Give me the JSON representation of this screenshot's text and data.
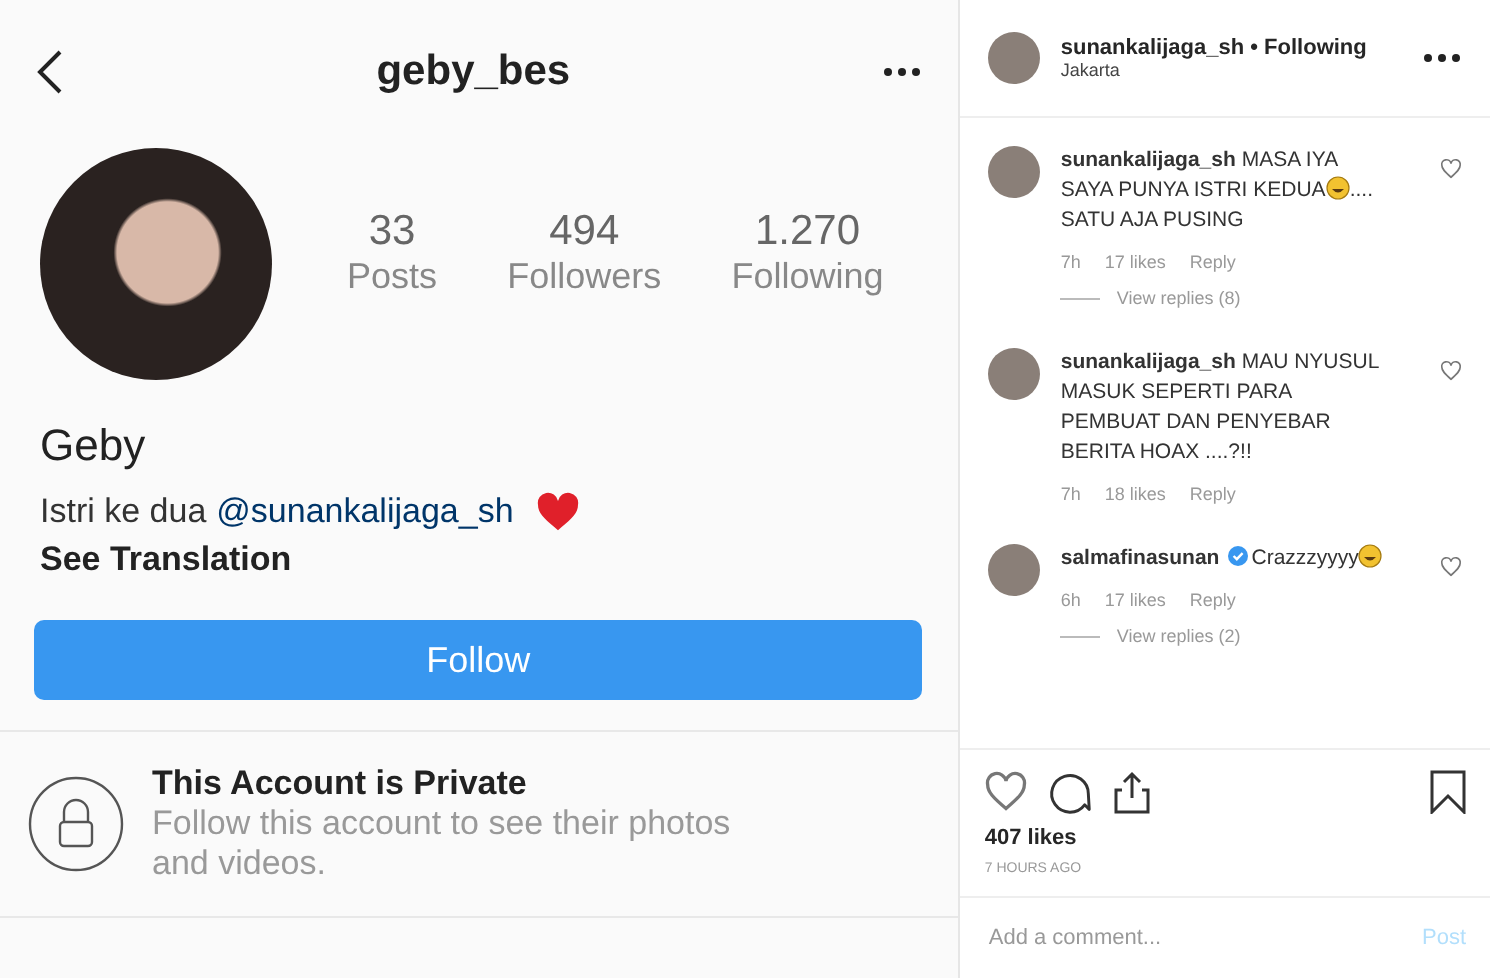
{
  "profile": {
    "username": "geby_bes",
    "stats": [
      {
        "value": "33",
        "label": "Posts"
      },
      {
        "value": "494",
        "label": "Followers"
      },
      {
        "value": "1.270",
        "label": "Following"
      }
    ],
    "name": "Geby",
    "bio": "Istri ke dua",
    "bio_mention": "@sunankalijaga_sh",
    "see_translation": "See Translation",
    "follow_button": "Follow",
    "private_title": "This Account is Private",
    "private_text": "Follow this account to see their photos and videos."
  },
  "post": {
    "author": "sunankalijaga_sh",
    "follow_state": "• Following",
    "location": "Jakarta",
    "comments": [
      {
        "author": "sunankalijaga_sh",
        "verified": false,
        "text_before": "MASA IYA SAYA PUNYA ISTRI KEDUA",
        "emoji": true,
        "text_after": ".... SATU AJA PUSING",
        "time": "7h",
        "likes": "17 likes",
        "reply": "Reply",
        "view_replies": "View replies (8)"
      },
      {
        "author": "sunankalijaga_sh",
        "verified": false,
        "text_before": "MAU NYUSUL MASUK SEPERTI PARA PEMBUAT DAN PENYEBAR BERITA HOAX ....?!!",
        "emoji": false,
        "time": "7h",
        "likes": "18 likes",
        "reply": "Reply"
      },
      {
        "author": "salmafinasunan",
        "verified": true,
        "text_before": "Crazzzyyyy",
        "emoji": true,
        "time": "6h",
        "likes": "17 likes",
        "reply": "Reply",
        "view_replies": "View replies (2)"
      }
    ],
    "likes": "407 likes",
    "time_ago": "7 HOURS AGO",
    "comment_placeholder": "Add a comment...",
    "post_button": "Post"
  }
}
